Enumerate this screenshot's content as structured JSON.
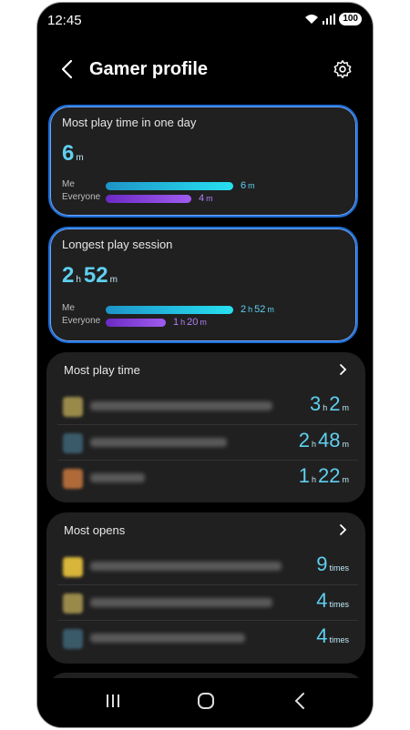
{
  "status": {
    "time": "12:45",
    "battery": "100"
  },
  "header": {
    "title": "Gamer profile"
  },
  "day_card": {
    "title": "Most play time in one day",
    "value_num": "6",
    "value_unit": "m",
    "me_label": "Me",
    "everyone_label": "Everyone",
    "me_num": "6",
    "me_unit": "m",
    "me_fraction": 1.0,
    "everyone_num": "4",
    "everyone_unit": "m",
    "everyone_fraction": 0.67
  },
  "session_card": {
    "title": "Longest play session",
    "value_h": "2",
    "value_h_unit": "h",
    "value_m": "52",
    "value_m_unit": "m",
    "me_label": "Me",
    "everyone_label": "Everyone",
    "me_h": "2",
    "me_h_unit": "h",
    "me_m": "52",
    "me_m_unit": "m",
    "me_fraction": 1.0,
    "everyone_h": "1",
    "everyone_h_unit": "h",
    "everyone_m": "20",
    "everyone_m_unit": "m",
    "everyone_fraction": 0.47
  },
  "most_play_time": {
    "title": "Most play time",
    "rows": [
      {
        "h": "3",
        "h_unit": "h",
        "m": "2",
        "m_unit": "m"
      },
      {
        "h": "2",
        "h_unit": "h",
        "m": "48",
        "m_unit": "m"
      },
      {
        "h": "1",
        "h_unit": "h",
        "m": "22",
        "m_unit": "m"
      }
    ]
  },
  "most_opens": {
    "title": "Most opens",
    "rows": [
      {
        "count": "9",
        "unit": "times"
      },
      {
        "count": "4",
        "unit": "times"
      },
      {
        "count": "4",
        "unit": "times"
      }
    ]
  },
  "colors": {
    "accent": "#5fd0f0",
    "everyone": "#a05cf0",
    "highlight_border": "#1e6fd6",
    "card": "#202020"
  }
}
